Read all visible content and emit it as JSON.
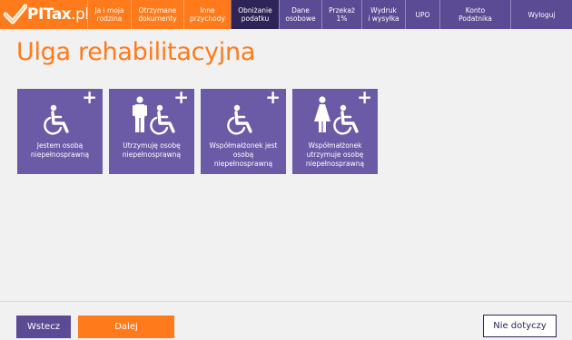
{
  "brand": {
    "logo_bold": "PITax",
    "logo_light": ".pl",
    "colors": {
      "orange": "#ff7a1a",
      "purple": "#5b4b94",
      "dark_purple": "#2e2458",
      "tile": "#6b5aa6"
    }
  },
  "nav": {
    "items": [
      {
        "label": "Ja i moja\nrodzina",
        "state": "orange"
      },
      {
        "label": "Otrzymane\ndokumenty",
        "state": "orange"
      },
      {
        "label": "Inne\nprzychody",
        "state": "orange"
      },
      {
        "label": "Obniżanie\npodatku",
        "state": "active"
      },
      {
        "label": "Dane\nosobowe",
        "state": "purple"
      },
      {
        "label": "Przekaż\n1%",
        "state": "purple"
      },
      {
        "label": "Wydruk\ni wysyłka",
        "state": "purple"
      },
      {
        "label": "UPO",
        "state": "purple"
      },
      {
        "label": "Konto\nPodatnika",
        "state": "purple"
      },
      {
        "label": "Wyloguj",
        "state": "purple"
      }
    ]
  },
  "page": {
    "title": "Ulga rehabilitacyjna"
  },
  "tiles": [
    {
      "label": "Jestem osobą niepełnosprawną",
      "icons": [
        "wheelchair-icon"
      ]
    },
    {
      "label": "Utrzymuję osobę niepełnosprawną",
      "icons": [
        "man-icon",
        "wheelchair-icon"
      ]
    },
    {
      "label": "Współmałżonek jest osobą niepełnosprawną",
      "icons": [
        "wheelchair-icon"
      ]
    },
    {
      "label": "Współmałżonek utrzymuje osobę niepełnosprawną",
      "icons": [
        "woman-icon",
        "wheelchair-icon"
      ]
    }
  ],
  "tile_plus": "+",
  "footer": {
    "back": "Wstecz",
    "next": "Dalej",
    "not_applicable": "Nie dotyczy"
  }
}
